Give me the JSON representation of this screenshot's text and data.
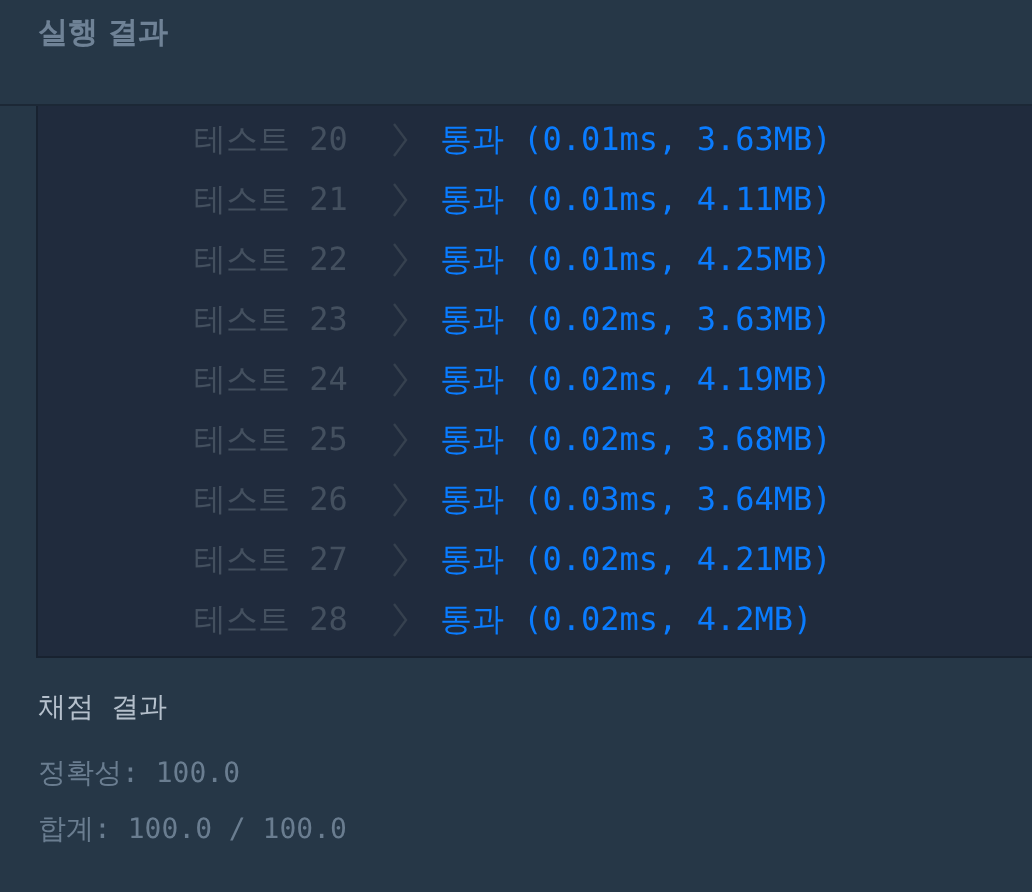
{
  "header": {
    "title": "실행 결과"
  },
  "tests": [
    {
      "label": "테스트 20",
      "passed": true,
      "result": "통과 (0.01ms, 3.63MB)"
    },
    {
      "label": "테스트 21",
      "passed": true,
      "result": "통과 (0.01ms, 4.11MB)"
    },
    {
      "label": "테스트 22",
      "passed": true,
      "result": "통과 (0.01ms, 4.25MB)"
    },
    {
      "label": "테스트 23",
      "passed": true,
      "result": "통과 (0.02ms, 3.63MB)"
    },
    {
      "label": "테스트 24",
      "passed": true,
      "result": "통과 (0.02ms, 4.19MB)"
    },
    {
      "label": "테스트 25",
      "passed": true,
      "result": "통과 (0.02ms, 3.68MB)"
    },
    {
      "label": "테스트 26",
      "passed": true,
      "result": "통과 (0.03ms, 3.64MB)"
    },
    {
      "label": "테스트 27",
      "passed": true,
      "result": "통과 (0.02ms, 4.21MB)"
    },
    {
      "label": "테스트 28",
      "passed": true,
      "result": "통과 (0.02ms, 4.2MB)"
    }
  ],
  "grading": {
    "title": "채점 결과",
    "lines": [
      "정확성: 100.0",
      "합계: 100.0 / 100.0"
    ]
  }
}
